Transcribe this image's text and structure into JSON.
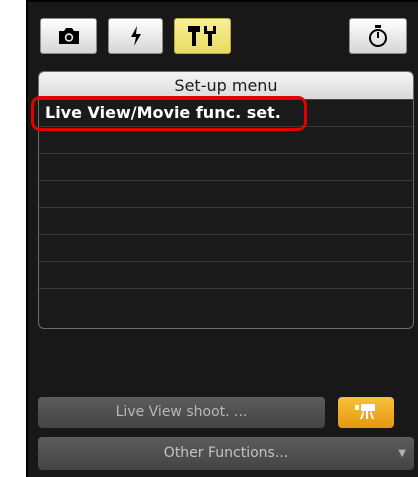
{
  "tabs": [
    {
      "icon": "camera-icon",
      "active": false
    },
    {
      "icon": "flash-icon",
      "active": false
    },
    {
      "icon": "setup-tools-icon",
      "active": true
    },
    {
      "icon": "timer-icon",
      "active": false
    }
  ],
  "menu": {
    "header": "Set-up menu",
    "items": [
      "Live View/Movie func. set.",
      "",
      "",
      "",
      "",
      "",
      "",
      ""
    ]
  },
  "buttons": {
    "live_view_shoot": "Live View shoot. ...",
    "movie_icon": "movie-camera-icon",
    "other_functions": "Other Functions...",
    "dropdown_arrow": "▼"
  },
  "colors": {
    "active_tab": "#f0e47a",
    "highlight_border": "#e00000",
    "movie_button": "#f2b02b"
  }
}
